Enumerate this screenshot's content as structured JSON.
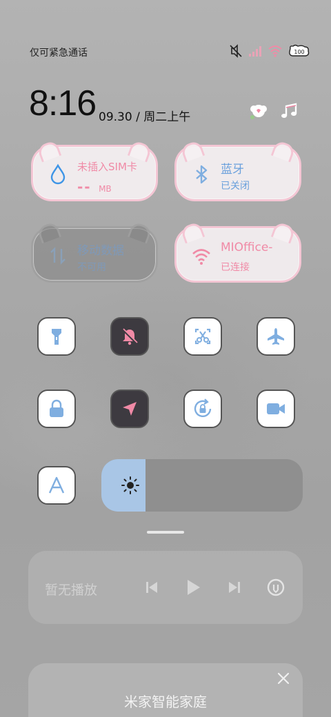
{
  "status_bar": {
    "carrier": "仅可紧急通话",
    "icons": [
      "mute-icon",
      "signal-icon",
      "wifi-icon",
      "battery-icon"
    ],
    "battery": "100"
  },
  "clock": {
    "time": "8:16",
    "date": "09.30 / 周二上午"
  },
  "top_icons": [
    "flower-edit-icon",
    "music-note-icon"
  ],
  "tiles": {
    "sim": {
      "title": "未插入SIM卡",
      "data_value": "--",
      "data_unit": "MB",
      "icon": "water-drop-icon"
    },
    "bluetooth": {
      "title": "蓝牙",
      "status": "已关闭",
      "icon": "bluetooth-icon"
    },
    "mobile_data": {
      "title": "移动数据",
      "status": "不可用",
      "icon": "data-arrows-icon"
    },
    "wifi": {
      "title": "MIOffice-",
      "status": "已连接",
      "icon": "wifi-icon"
    }
  },
  "toggles": [
    {
      "name": "flashlight",
      "icon": "flashlight-icon",
      "on": false
    },
    {
      "name": "silent",
      "icon": "bell-off-icon",
      "on": true
    },
    {
      "name": "screenshot",
      "icon": "scissors-icon",
      "on": false
    },
    {
      "name": "airplane",
      "icon": "airplane-icon",
      "on": false
    },
    {
      "name": "lock",
      "icon": "lock-icon",
      "on": false
    },
    {
      "name": "location",
      "icon": "location-arrow-icon",
      "on": true
    },
    {
      "name": "rotation-lock",
      "icon": "rotation-lock-icon",
      "on": false
    },
    {
      "name": "screen-record",
      "icon": "video-camera-icon",
      "on": false
    },
    {
      "name": "font-size",
      "icon": "letter-a-icon",
      "on": false
    }
  ],
  "brightness": {
    "level": 0.22,
    "icon": "sun-icon"
  },
  "media": {
    "label": "暂无播放",
    "controls": [
      "previous-icon",
      "play-icon",
      "next-icon",
      "cast-icon"
    ]
  },
  "smart_home": {
    "title": "米家智能家庭",
    "close_icon": "close-icon"
  },
  "colors": {
    "accent_blue": "#5ea2e8",
    "accent_pink": "#f08aa6",
    "tile_border": "#f4c6d4"
  }
}
